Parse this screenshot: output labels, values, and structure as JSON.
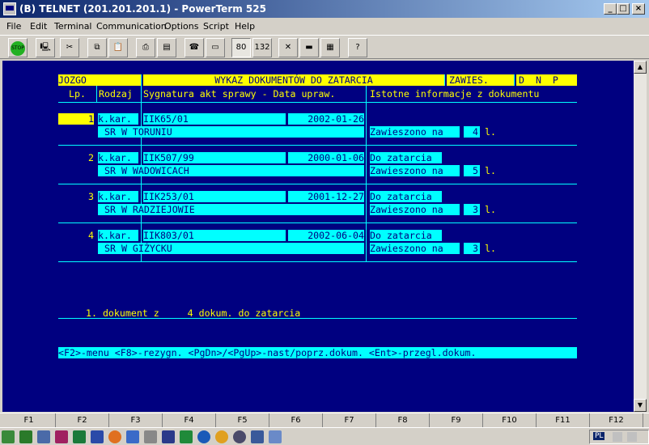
{
  "window": {
    "title": "(B) TELNET (201.201.201.1) - PowerTerm 525"
  },
  "menu": [
    "File",
    "Edit",
    "Terminal",
    "Communication",
    "Options",
    "Script",
    "Help"
  ],
  "toolbar": {
    "stop": "STOP",
    "cols80": "80",
    "cols132": "132",
    "help": "?"
  },
  "screen": {
    "hdr_code": "JOZGO",
    "hdr_title": "WYKAZ DOKUMENTÓW DO ZATARCIA",
    "hdr_status": "ZAWIES.",
    "hdr_flags": "D  N  P",
    "col_lp": "Lp.",
    "col_rodzaj": "Rodzaj",
    "col_sygn": "Sygnatura akt sprawy - Data upraw.",
    "col_info": "Istotne informacje z dokumentu",
    "records": [
      {
        "lp": "1",
        "rodzaj": "k.kar.",
        "sygn": "IIK65/01",
        "data": "2002-01-26",
        "info1": "",
        "court": "SR W TORUNIU",
        "info2_label": "Zawieszono na",
        "info2_num": "4",
        "info2_unit": "l."
      },
      {
        "lp": "2",
        "rodzaj": "k.kar.",
        "sygn": "IIK507/99",
        "data": "2000-01-06",
        "info1": "Do zatarcia",
        "court": "SR W WADOWICACH",
        "info2_label": "Zawieszono na",
        "info2_num": "5",
        "info2_unit": "l."
      },
      {
        "lp": "3",
        "rodzaj": "k.kar.",
        "sygn": "IIK253/01",
        "data": "2001-12-27",
        "info1": "Do zatarcia",
        "court": "SR W RADZIEJOWIE",
        "info2_label": "Zawieszono na",
        "info2_num": "3",
        "info2_unit": "l."
      },
      {
        "lp": "4",
        "rodzaj": "k.kar.",
        "sygn": "IIK803/01",
        "data": "2002-06-04",
        "info1": "Do zatarcia",
        "court": "SR W GIŻYCKU",
        "info2_label": "Zawieszono na",
        "info2_num": "3",
        "info2_unit": "l."
      }
    ],
    "summary": "1. dokument z     4 dokum. do zatarcia",
    "help_line": "<F2>-menu <F8>-rezygn. <PgDn>/<PgUp>-nast/poprz.dokum. <Ent>-przegl.dokum."
  },
  "fkeys": [
    "F1",
    "F2",
    "F3",
    "F4",
    "F5",
    "F6",
    "F7",
    "F8",
    "F9",
    "F10",
    "F11",
    "F12"
  ],
  "tray": {
    "lang": "PL"
  },
  "colors": {
    "screen_bg": "#000080",
    "field": "#00ffff",
    "header": "#ffff00",
    "titlebar": "#0a246a"
  }
}
